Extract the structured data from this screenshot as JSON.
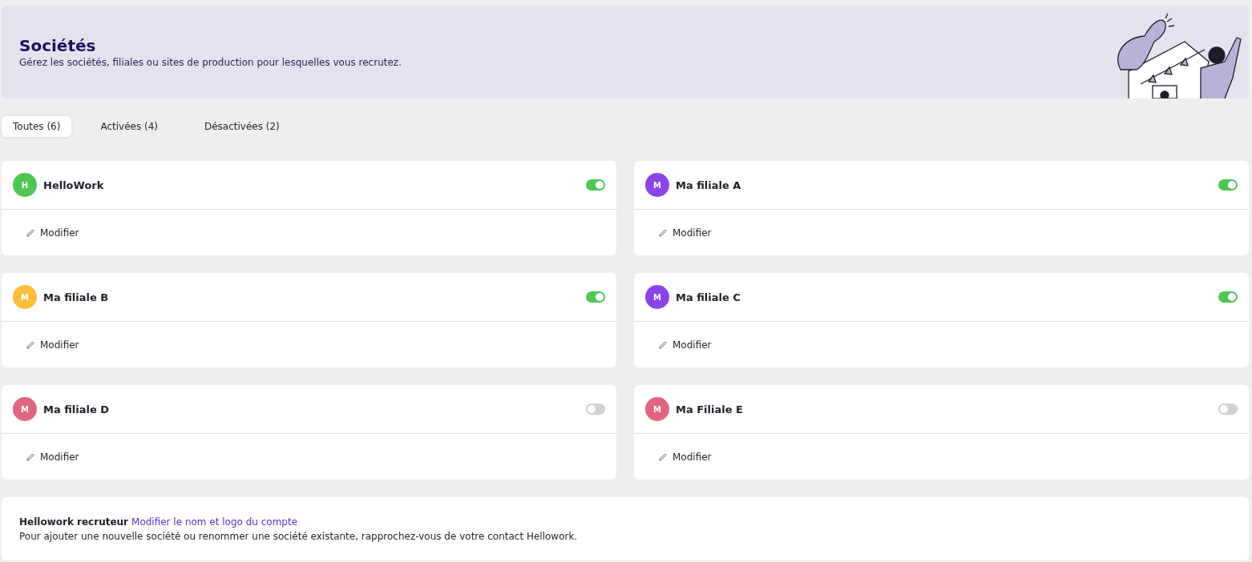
{
  "header": {
    "title": "Sociétés",
    "subtitle": "Gérez les sociétés, filiales ou sites de production pour lesquelles vous recrutez."
  },
  "tabs": [
    {
      "label": "Toutes (6)",
      "selected": true
    },
    {
      "label": "Activées (4)",
      "selected": false
    },
    {
      "label": "Désactivées (2)",
      "selected": false
    }
  ],
  "companies": [
    {
      "initial": "H",
      "name": "HelloWork",
      "color": "#4fc553",
      "on": true,
      "action": "Modifier"
    },
    {
      "initial": "M",
      "name": "Ma filiale A",
      "color": "#8b44e8",
      "on": true,
      "action": "Modifier"
    },
    {
      "initial": "M",
      "name": "Ma filiale B",
      "color": "#fbbd3a",
      "on": true,
      "action": "Modifier"
    },
    {
      "initial": "M",
      "name": "Ma filiale C",
      "color": "#8b44e8",
      "on": true,
      "action": "Modifier"
    },
    {
      "initial": "M",
      "name": "Ma filiale D",
      "color": "#e06580",
      "on": false,
      "action": "Modifier"
    },
    {
      "initial": "M",
      "name": "Ma Filiale E",
      "color": "#e06580",
      "on": false,
      "action": "Modifier"
    }
  ],
  "footer": {
    "account": "Hellowork recruteur",
    "link": "Modifier le nom et logo du compte",
    "note": "Pour ajouter une nouvelle société ou renommer une société existante, rapprochez-vous de votre contact Hellowork."
  }
}
